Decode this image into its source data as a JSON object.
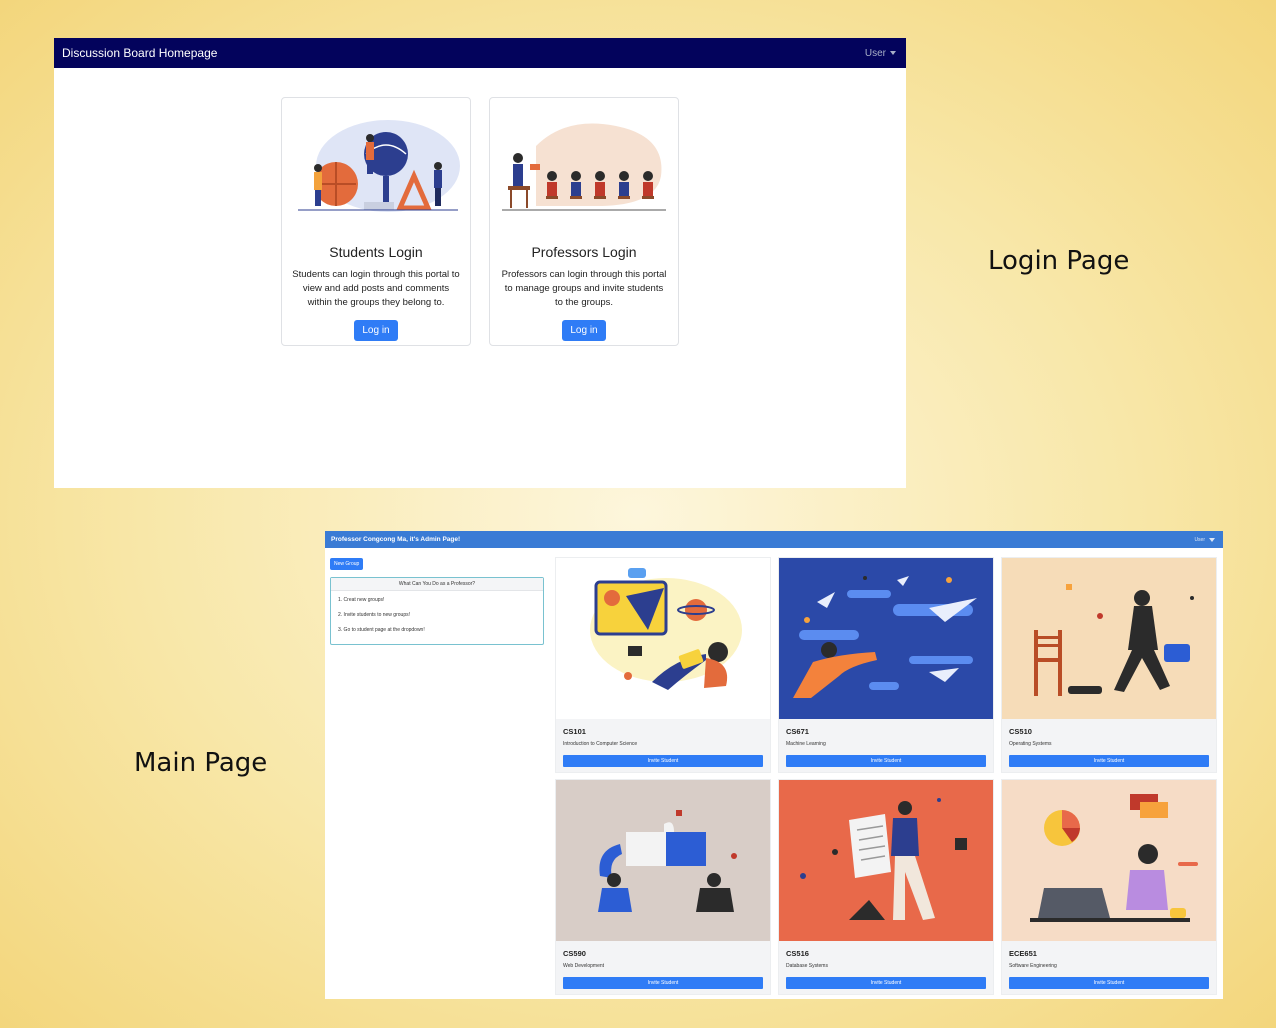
{
  "captions": {
    "login": "Login Page",
    "main": "Main Page"
  },
  "login_page": {
    "navbar": {
      "brand": "Discussion Board Homepage",
      "user_menu": "User"
    },
    "cards": [
      {
        "title": "Students Login",
        "text": "Students can login through this portal to view and add posts and comments within the groups they belong to.",
        "button": "Log in"
      },
      {
        "title": "Professors Login",
        "text": "Professors can login through this portal to manage groups and invite students to the groups.",
        "button": "Log in"
      }
    ]
  },
  "main_page": {
    "navbar": {
      "brand": "Professor Congcong Ma, it's Admin Page!",
      "user_menu": "User"
    },
    "new_group_button": "New Group",
    "info_box": {
      "title": "What Can You Do as a Professor?",
      "items": [
        "1. Creat new groups!",
        "2. Invite students to new groups!",
        "3. Go to student page at the dropdown!"
      ]
    },
    "courses": [
      {
        "code": "CS101",
        "name": "Introduction to Computer Science",
        "button": "Invite Student"
      },
      {
        "code": "CS671",
        "name": "Machine Learning",
        "button": "Invite Student"
      },
      {
        "code": "CS510",
        "name": "Operating Systems",
        "button": "Invite Student"
      },
      {
        "code": "CS590",
        "name": "Web Development",
        "button": "Invite Student"
      },
      {
        "code": "CS516",
        "name": "Database Systems",
        "button": "Invite Student"
      },
      {
        "code": "ECE651",
        "name": "Software Engineering",
        "button": "Invite Student"
      }
    ]
  },
  "colors": {
    "login_nav": "#03035c",
    "main_nav": "#3a7bd5",
    "button": "#2f7cf6",
    "background": "#f8e7a8"
  }
}
